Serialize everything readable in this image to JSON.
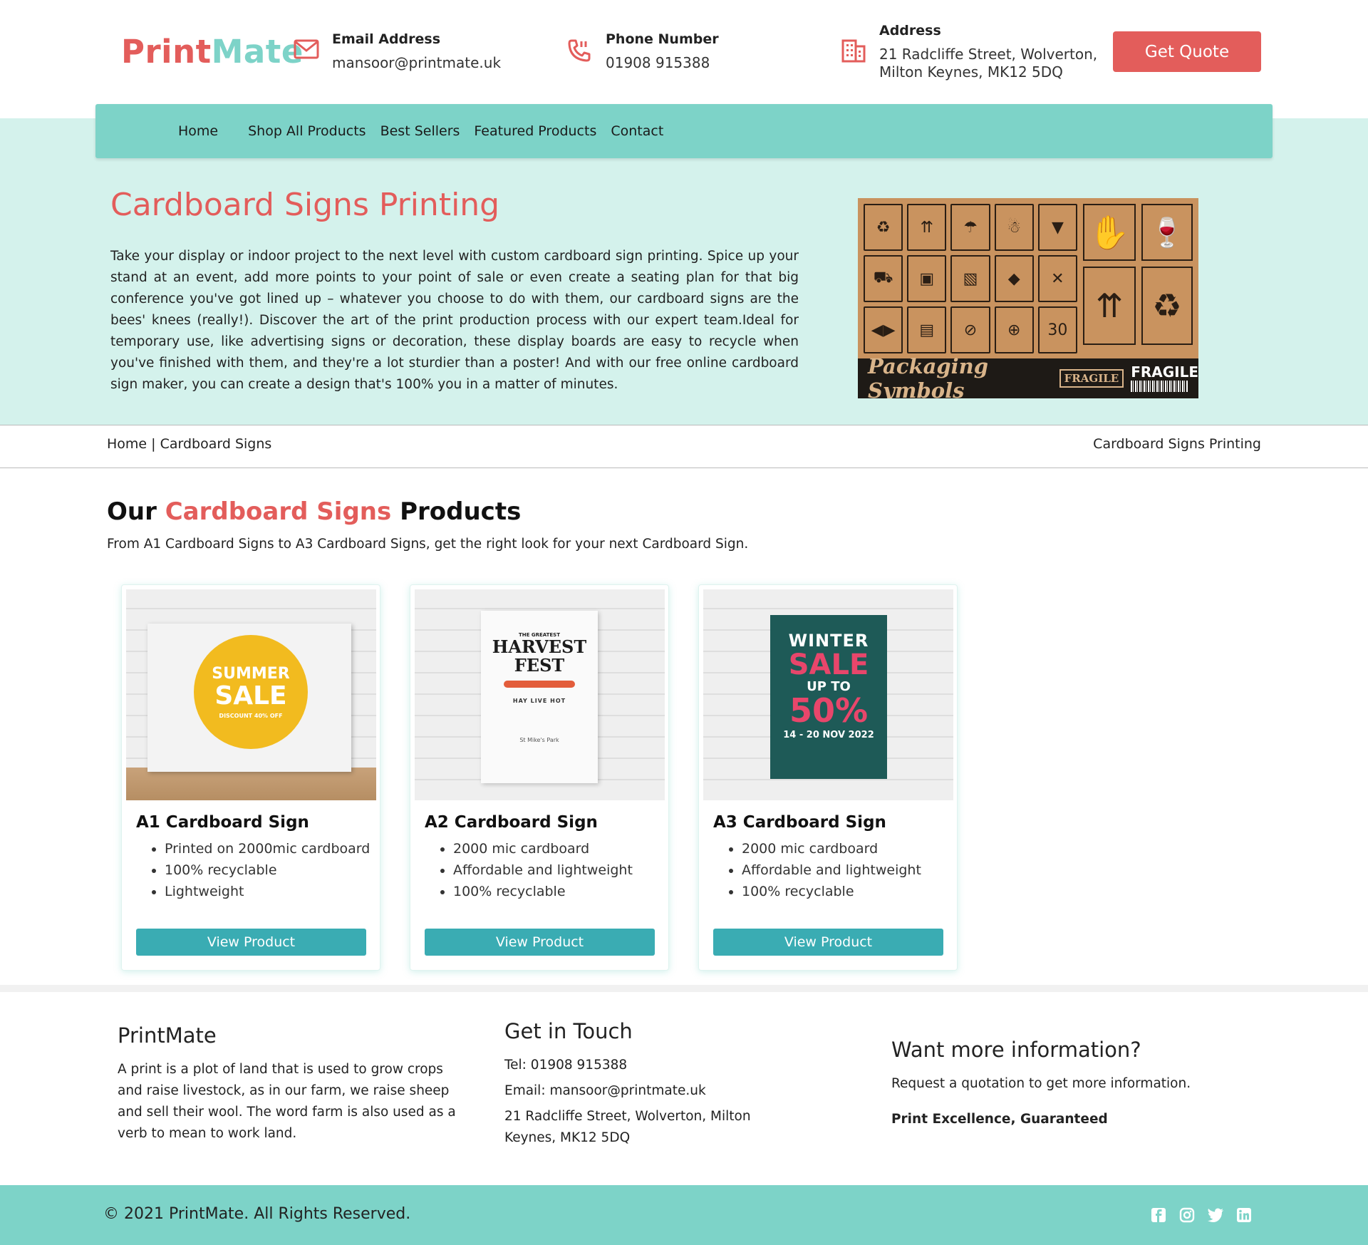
{
  "brand": {
    "part1": "Print",
    "part2": "Mate"
  },
  "header": {
    "email_title": "Email Address",
    "email_value": "mansoor@printmate.uk",
    "phone_title": "Phone Number",
    "phone_value": "01908 915388",
    "address_title": "Address",
    "address_line1": "21 Radcliffe Street, Wolverton,",
    "address_line2": "Milton Keynes, MK12 5DQ",
    "quote_label": "Get Quote"
  },
  "nav": {
    "items": [
      {
        "label": "Home"
      },
      {
        "label": "Shop All Products"
      },
      {
        "label": "Best Sellers"
      },
      {
        "label": "Featured Products"
      },
      {
        "label": "Contact"
      }
    ]
  },
  "hero": {
    "title": "Cardboard Signs Printing",
    "text": "Take your display or indoor project to the next level with custom cardboard sign printing. Spice up your stand at an event, add more points to your point of sale or even create a seating plan for that big conference you've got lined up – whatever you choose to do with them, our cardboard signs are the bees' knees (really!). Discover the art of the print production process with our expert team.Ideal for temporary use, like advertising signs or decoration, these display boards are easy to recycle when you've finished with them, and they're a lot sturdier than a poster! And with our free online cardboard sign maker, you can create a design that's 100% you in a matter of minutes.",
    "image": {
      "banner": "Packaging Symbols",
      "fragile_box": "FRAGILE",
      "fragile": "FRAGILE",
      "this_way_up": "THIS WAY UP",
      "thirty": "30"
    }
  },
  "breadcrumb": {
    "left": "Home | Cardboard Signs",
    "right": "Cardboard Signs Printing"
  },
  "products_section": {
    "title_pre": "Our ",
    "title_accent": "Cardboard Signs",
    "title_post": " Products",
    "subtitle": "From A1 Cardboard Signs to A3 Cardboard Signs, get the right look for your next Cardboard Sign.",
    "button_label": "View Product",
    "cards": [
      {
        "title": "A1 Cardboard Sign",
        "features": [
          "Printed on 2000mic cardboard",
          "100% recyclable",
          "Lightweight"
        ],
        "art": {
          "l1": "SUMMER",
          "l2": "SALE",
          "l3": "DISCOUNT 40% OFF"
        }
      },
      {
        "title": "A2 Cardboard Sign",
        "features": [
          "2000 mic cardboard",
          "Affordable and lightweight",
          "100% recyclable"
        ],
        "art": {
          "l0": "THE GREATEST",
          "l1": "HARVEST",
          "l2": "FEST",
          "l3": "HAY   LIVE   HOT",
          "l4": "St Mike's Park"
        }
      },
      {
        "title": "A3 Cardboard Sign",
        "features": [
          "2000 mic cardboard",
          "Affordable and lightweight",
          "100% recyclable"
        ],
        "art": {
          "l1": "WINTER",
          "l2": "SALE",
          "l3": "UP TO",
          "l4": "50%",
          "l5": "14 - 20 NOV 2022"
        }
      }
    ]
  },
  "footer": {
    "col1_title": "PrintMate",
    "col1_text": "A print is a plot of land that is used to grow crops and raise livestock, as in our farm, we raise sheep and sell their wool. The word farm is also used as a verb to mean to work land.",
    "col2_title": "Get in Touch",
    "col2_tel": "Tel: 01908 915388",
    "col2_email": "Email: mansoor@printmate.uk",
    "col2_address": "21 Radcliffe Street, Wolverton, Milton Keynes, MK12 5DQ",
    "col3_title": "Want more information?",
    "col3_text": "Request a quotation to get more information.",
    "col3_strong": "Print Excellence, Guaranteed",
    "copyright": "© 2021 PrintMate. All Rights Reserved.",
    "social_icons": [
      "facebook-icon",
      "instagram-icon",
      "twitter-icon",
      "linkedin-icon"
    ]
  },
  "colors": {
    "brand_red": "#e35d5b",
    "brand_teal": "#7dd3c8",
    "hero_bg": "#d4f2ec",
    "button_teal": "#3aacb3"
  }
}
